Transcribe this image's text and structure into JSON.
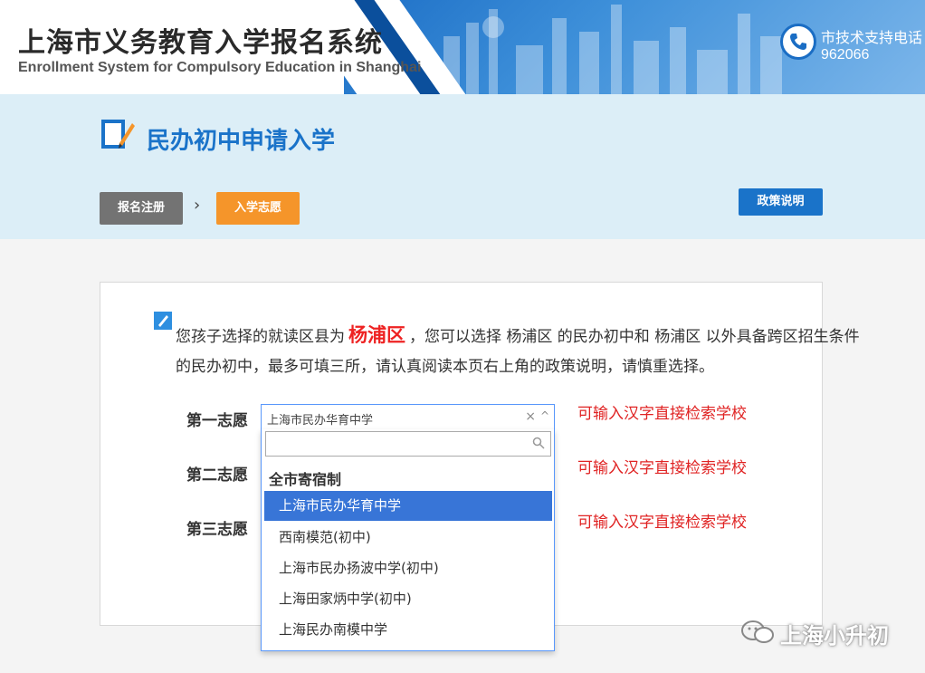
{
  "header": {
    "title_cn": "上海市义务教育入学报名系统",
    "title_en": "Enrollment System for Compulsory Education in Shanghai",
    "support_label": "市技术支持电话",
    "support_phone": "962066"
  },
  "page": {
    "title": "民办初中申请入学",
    "steps": [
      "报名注册",
      "入学志愿"
    ],
    "step_arrow": "›",
    "policy_button": "政策说明"
  },
  "intro": {
    "line1_prefix": "您孩子选择的就读区县为",
    "district": "杨浦区",
    "line1_suffix": "，您可以选择 杨浦区 的民办初中和 杨浦区 以外具备跨区招生条件",
    "line2": "的民办初中，最多可填三所，请认真阅读本页右上角的政策说明，请慎重选择。"
  },
  "wishes": {
    "labels": [
      "第一志愿",
      "第二志愿",
      "第三志愿"
    ],
    "hint": "可输入汉字直接检索学校",
    "first_selected": "上海市民办华育中学",
    "clear_symbol": "×",
    "caret_symbol": "^"
  },
  "dropdown": {
    "search_value": "",
    "group": "全市寄宿制",
    "options": [
      "上海市民办华育中学",
      "西南模范(初中)",
      "上海市民办扬波中学(初中)",
      "上海田家炳中学(初中)",
      "上海民办南模中学"
    ],
    "selected_index": 0
  },
  "watermark": {
    "text": "上海小升初"
  },
  "colors": {
    "primary_blue": "#1a73c9",
    "step_active": "#f5952a",
    "step_done": "#737373",
    "hint_red": "#e02424",
    "selected_option": "#3875d7"
  }
}
